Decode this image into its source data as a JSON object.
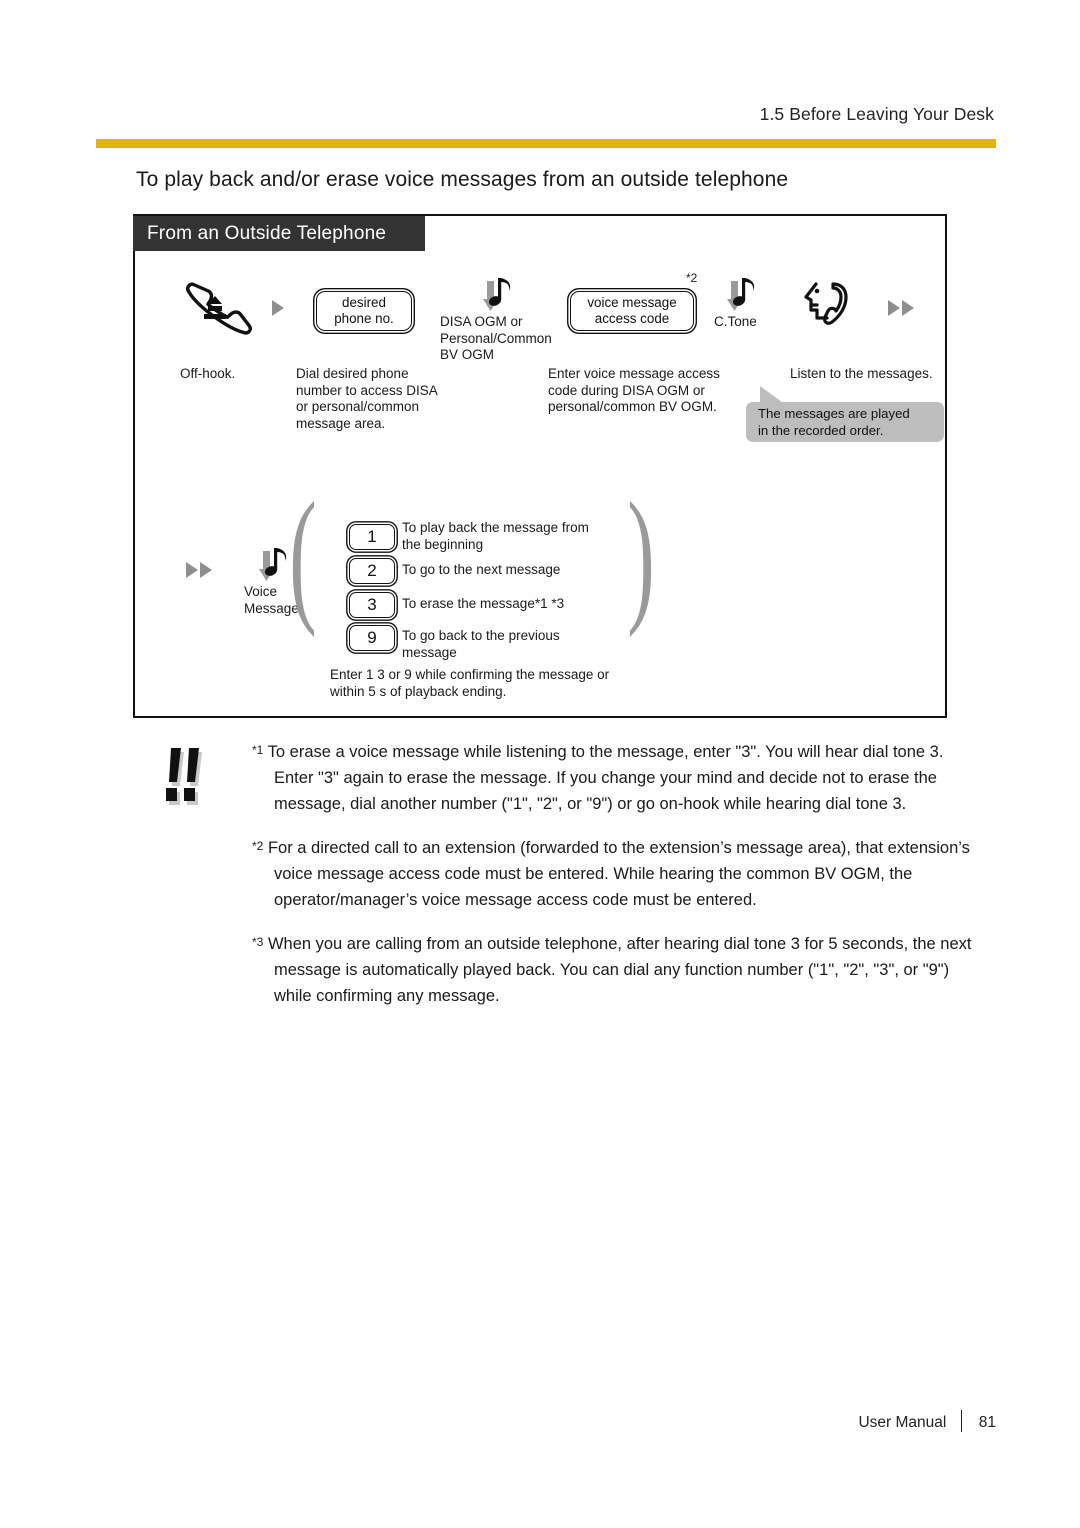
{
  "header": {
    "running_head": "1.5 Before Leaving Your Desk",
    "rule_color": "#e2b50e"
  },
  "section": {
    "title": "To play back and/or erase voice messages from an outside telephone"
  },
  "diagram": {
    "tab_label": "From an Outside Telephone",
    "steps": [
      {
        "icon": "offhook-handset-icon",
        "caption": "Off-hook."
      },
      {
        "icon": "arrow-triangle-icon"
      },
      {
        "key_label_line1": "desired",
        "key_label_line2": "phone no.",
        "caption_line1": "Dial desired phone",
        "caption_line2": "number  to access DISA",
        "caption_line3": "or personal/common",
        "caption_line4": "message area."
      },
      {
        "icon": "tone-note-icon",
        "tone_line1": "DISA OGM or",
        "tone_line2": "Personal/Common",
        "tone_line3": "BV OGM"
      },
      {
        "key_label_line1": "voice message",
        "key_label_line2": "access code",
        "footnote_marker": "*2",
        "caption_line1": "Enter voice message access",
        "caption_line2": "code  during DISA OGM or",
        "caption_line3": "personal/common BV OGM."
      },
      {
        "icon": "tone-note-icon",
        "tone_label": "C.Tone"
      },
      {
        "icon": "listening-handset-icon",
        "caption": "Listen to the messages."
      },
      {
        "icon": "double-arrow-icon"
      }
    ],
    "callout": {
      "line1": "The messages are played",
      "line2": "in the recorded order.",
      "bg_color": "#bdbdbd"
    },
    "second_row": {
      "arrow_icon": "double-arrow-icon",
      "tone_icon": "tone-note-icon",
      "tone_label_line1": "Voice",
      "tone_label_line2": "Message",
      "options": [
        {
          "key": "1",
          "text_line1": "To play back the message from",
          "text_line2": "the beginning"
        },
        {
          "key": "2",
          "text_line1": "To go to the next message",
          "text_line2": ""
        },
        {
          "key": "3",
          "text_line1": "To erase the message*1 *3",
          "text_line2": ""
        },
        {
          "key": "9",
          "text_line1": "To go back to the previous",
          "text_line2": "message"
        }
      ],
      "footer_line1": "Enter 1 3  or 9 while confirming the message or",
      "footer_line2": "within 5 s of playback ending."
    }
  },
  "notes": {
    "icon": "double-exclamation-icon",
    "items": [
      {
        "marker": "*1",
        "text": "To erase a voice message while listening to the message, enter \"3\". You will hear dial tone 3. Enter \"3\" again to erase the message. If you change your mind and decide not to erase the message, dial another number (\"1\", \"2\", or \"9\") or go on-hook while hearing dial tone 3."
      },
      {
        "marker": "*2",
        "text": "For a directed call to an extension (forwarded to the extension’s message area), that extension’s voice message access code must be entered. While hearing the common BV OGM, the operator/manager’s voice message access code must be entered."
      },
      {
        "marker": "*3",
        "text": "When you are calling from an outside telephone, after hearing dial tone 3 for 5 seconds, the next message is automatically played back. You can dial any function number (\"1\", \"2\", \"3\", or \"9\") while confirming any message."
      }
    ]
  },
  "footer": {
    "label": "User Manual",
    "page": "81"
  }
}
